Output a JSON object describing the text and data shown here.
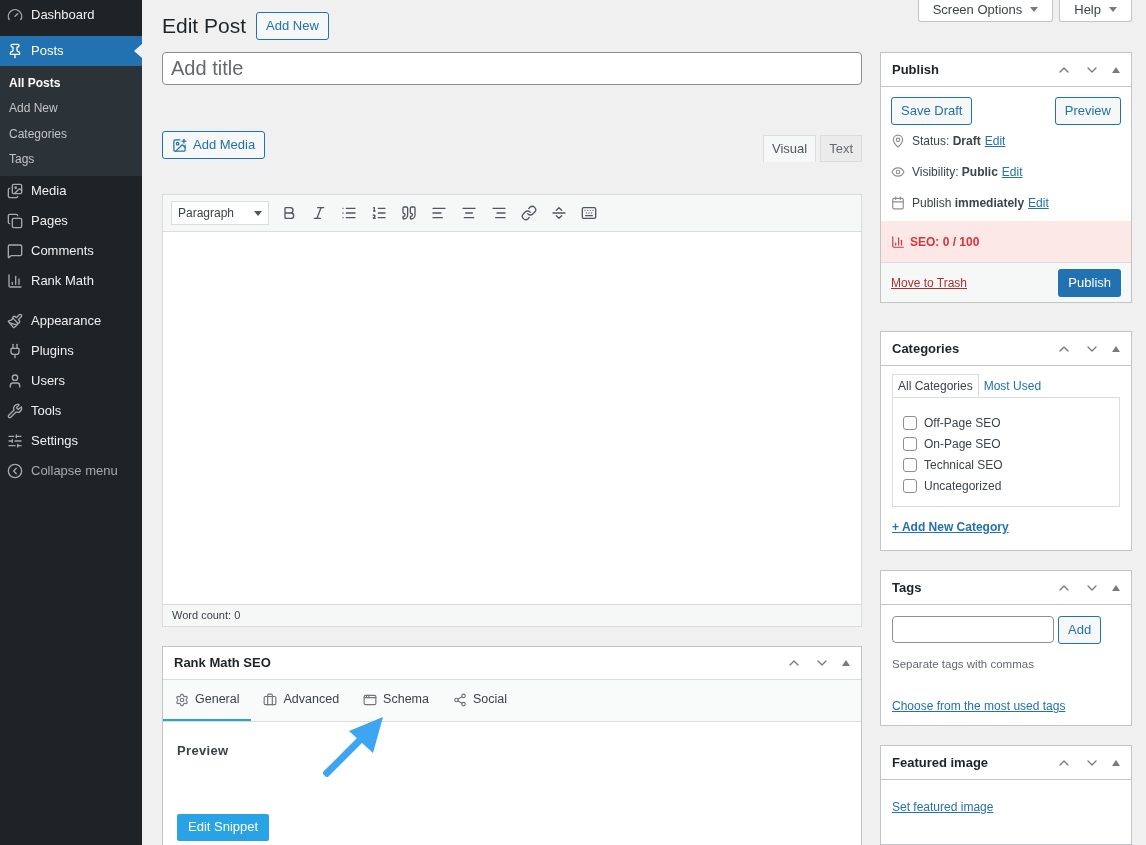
{
  "sidebar": {
    "items": [
      {
        "label": "Dashboard",
        "selected": false
      },
      {
        "label": "Posts",
        "selected": true,
        "children": [
          {
            "label": "All Posts",
            "selected": true
          },
          {
            "label": "Add New",
            "selected": false
          },
          {
            "label": "Categories",
            "selected": false
          },
          {
            "label": "Tags",
            "selected": false
          }
        ]
      },
      {
        "label": "Media",
        "selected": false
      },
      {
        "label": "Pages",
        "selected": false
      },
      {
        "label": "Comments",
        "selected": false
      },
      {
        "label": "Rank Math",
        "selected": false
      },
      {
        "label": "Appearance",
        "selected": false
      },
      {
        "label": "Plugins",
        "selected": false
      },
      {
        "label": "Users",
        "selected": false
      },
      {
        "label": "Tools",
        "selected": false
      },
      {
        "label": "Settings",
        "selected": false
      },
      {
        "label": "Collapse menu",
        "selected": false
      }
    ]
  },
  "top_buttons": [
    "Screen Options",
    "Help"
  ],
  "page_title": "Edit Post",
  "add_new": "Add New",
  "title_field": {
    "placeholder": "Add title"
  },
  "add_media": "Add Media",
  "editor_tabs": [
    {
      "label": "Visual",
      "selected": true
    },
    {
      "label": "Text",
      "selected": false
    }
  ],
  "format_select": "Paragraph",
  "word_count": "Word count: 0",
  "rank_math": {
    "title": "Rank Math SEO",
    "tabs": [
      {
        "label": "General",
        "selected": true
      },
      {
        "label": "Advanced",
        "selected": false
      },
      {
        "label": "Schema",
        "selected": false
      },
      {
        "label": "Social",
        "selected": false
      }
    ],
    "section": "Preview",
    "button": "Edit Snippet"
  },
  "publish": {
    "title": "Publish",
    "save_draft": "Save Draft",
    "preview": "Preview",
    "rows": [
      {
        "text": "Status: **Draft**",
        "link": "Edit"
      },
      {
        "text": "Visibility: **Public**",
        "link": "Edit"
      },
      {
        "text": "Publish **immediately**",
        "link": "Edit"
      }
    ],
    "seo": "SEO: 0 / 100",
    "trash": "Move to Trash",
    "publish": "Publish"
  },
  "categories": {
    "title": "Categories",
    "tabs": [
      {
        "label": "All Categories",
        "selected": true
      },
      {
        "label": "Most Used",
        "selected": false
      }
    ],
    "items": [
      {
        "label": "Off-Page SEO",
        "checked": false
      },
      {
        "label": "On-Page SEO",
        "checked": false
      },
      {
        "label": "Technical SEO",
        "checked": false
      },
      {
        "label": "Uncategorized",
        "checked": false
      }
    ],
    "add_link": "+ Add New Category"
  },
  "tags": {
    "title": "Tags",
    "button": "Add",
    "hint": "Separate tags with commas",
    "link": "Choose from the most used tags"
  },
  "featured_image": {
    "title": "Featured image",
    "link": "Set featured image"
  }
}
